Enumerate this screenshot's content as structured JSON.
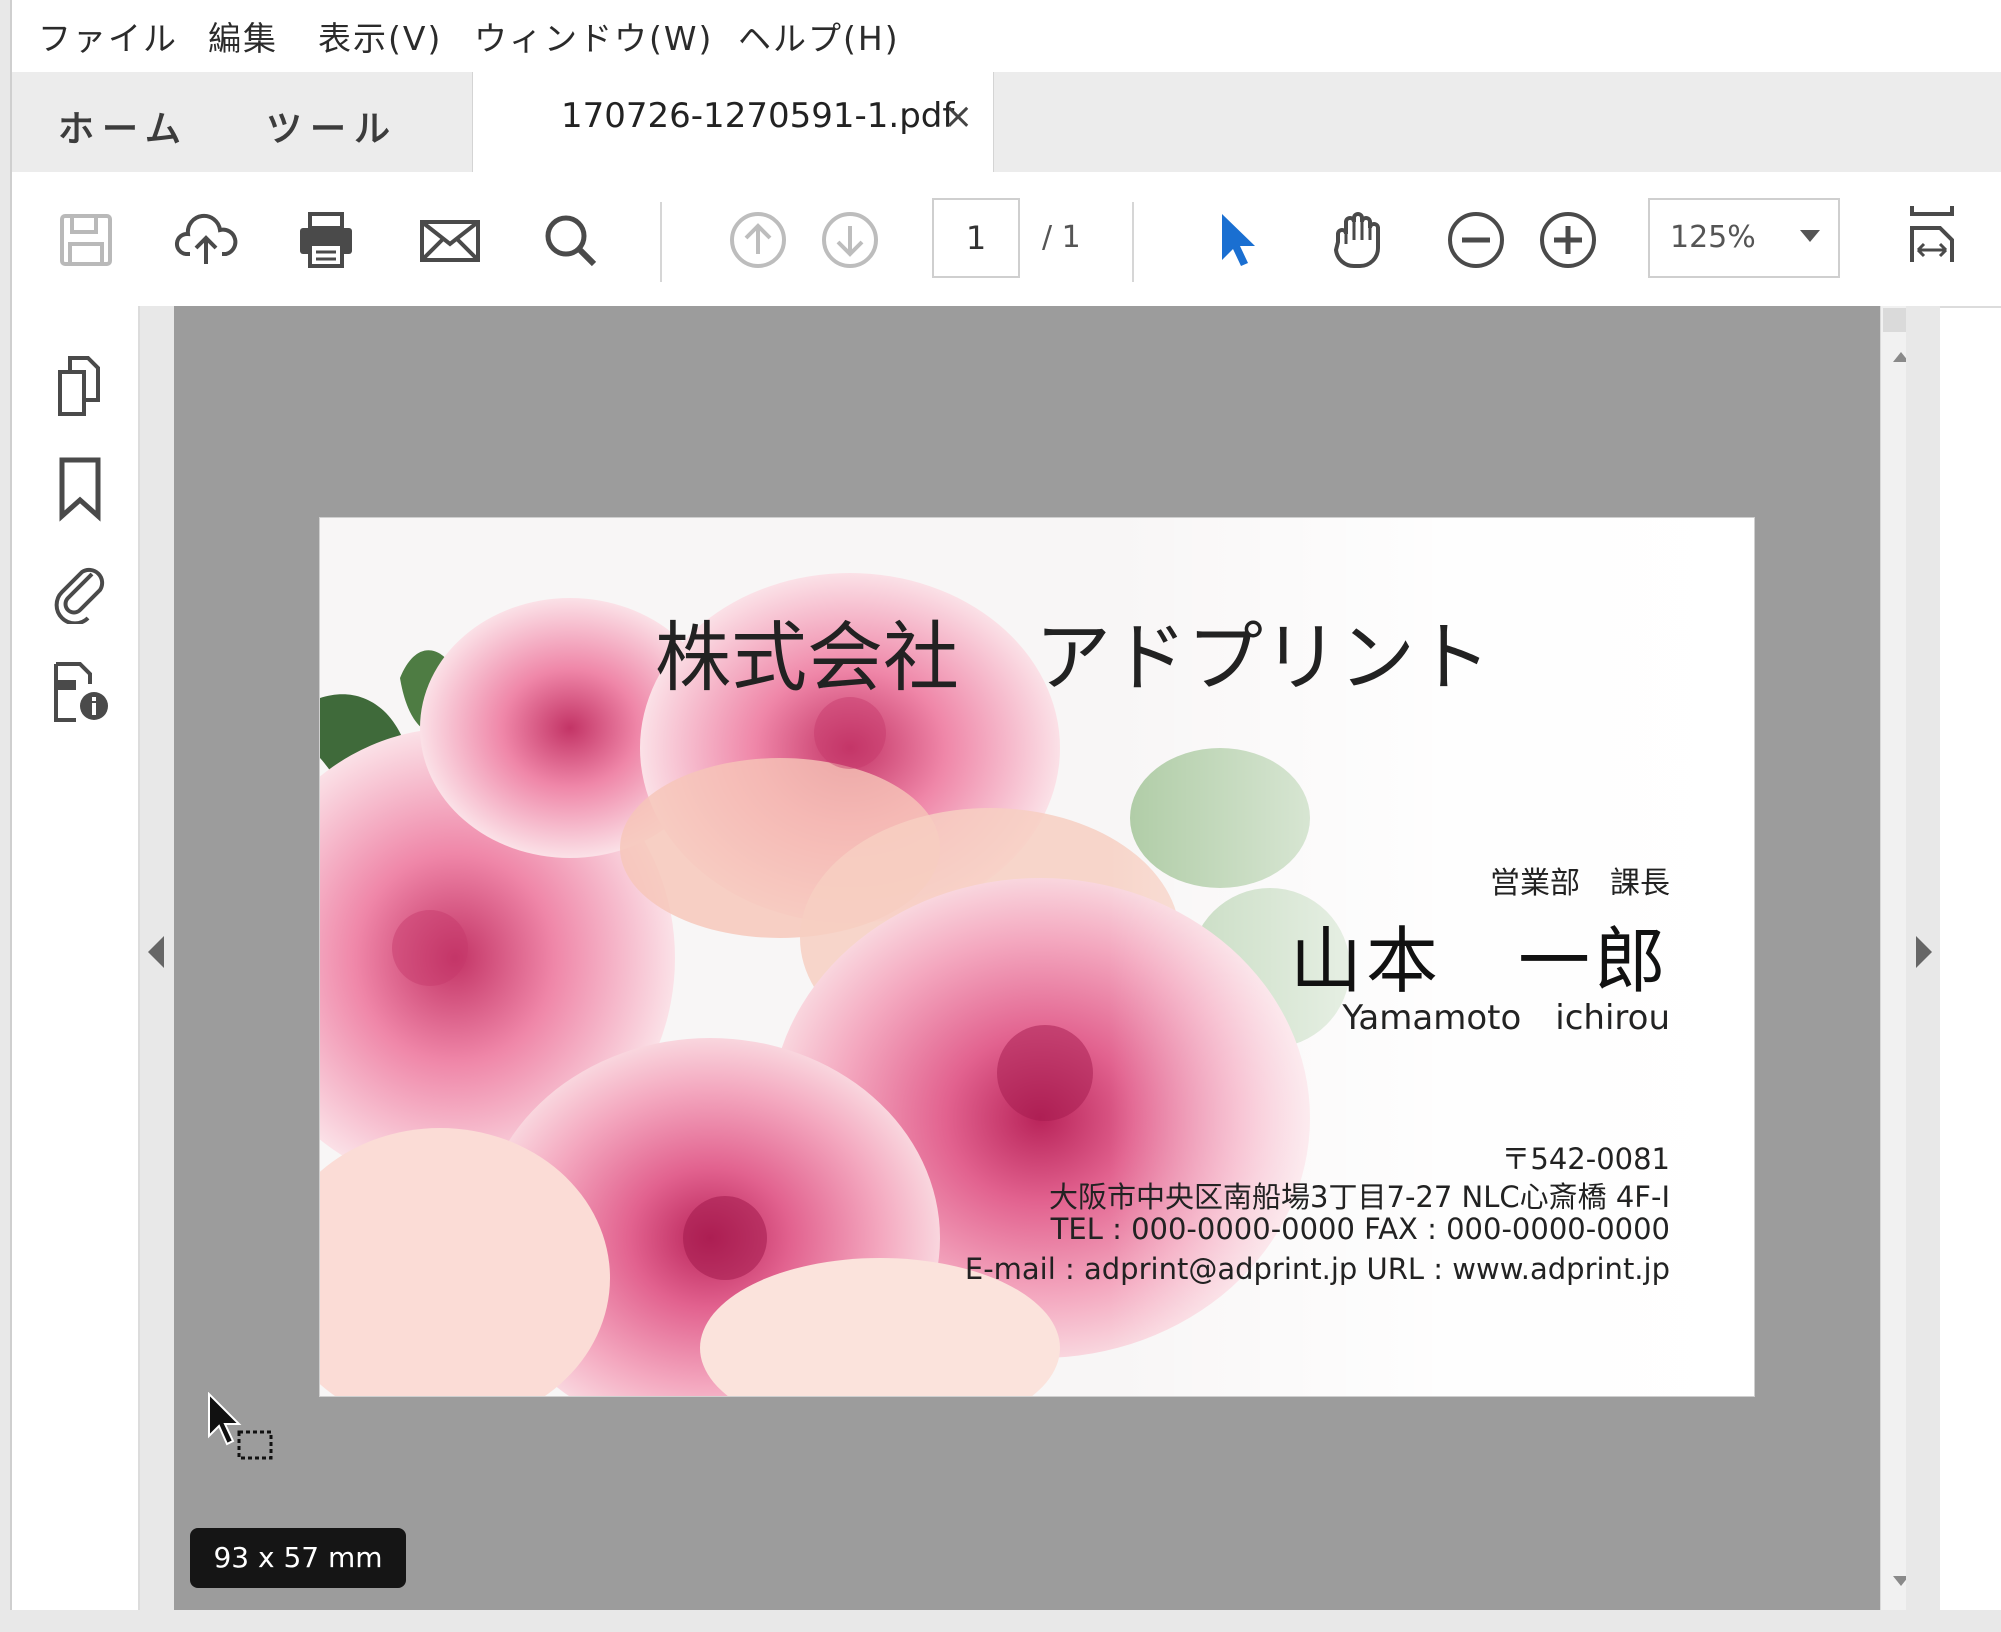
{
  "menu": {
    "file": "ファイル",
    "edit": "編集",
    "view": "表示(V)",
    "window": "ウィンドウ(W)",
    "help": "ヘルプ(H)"
  },
  "tabs": {
    "home": "ホーム",
    "tools": "ツール",
    "document": "170726-1270591-1.pdf",
    "close_glyph": "×"
  },
  "toolbar": {
    "page_current": "1",
    "page_total": "/ 1",
    "zoom": "125%",
    "icons": [
      "save-icon",
      "cloud-upload-icon",
      "print-icon",
      "mail-icon",
      "search-icon",
      "page-up-icon",
      "page-down-icon",
      "select-arrow-icon",
      "hand-icon",
      "zoom-out-icon",
      "zoom-in-icon",
      "fit-page-icon"
    ]
  },
  "leftrail": {
    "icons": [
      "pages-icon",
      "bookmark-icon",
      "attachment-icon",
      "document-info-icon"
    ]
  },
  "card": {
    "company": "株式会社　アドプリント",
    "dept_title": "営業部　課長",
    "name": "山本　一郎",
    "name_roman": "Yamamoto　ichirou",
    "postal": "〒542-0081",
    "address": "大阪市中央区南船場3丁目7-27 NLC心斎橋 4F-I",
    "tel_fax": "TEL : 000-0000-0000 FAX : 000-0000-0000",
    "email_url": "E-mail : adprint@adprint.jp  URL : www.adprint.jp"
  },
  "status": {
    "size_tooltip": "93 x 57 mm"
  },
  "colors": {
    "accent_blue": "#1a6fd1",
    "doc_area_gray": "#9c9c9c",
    "rose_pink": "#e26f9a",
    "leaf_green": "#8fb48a"
  }
}
